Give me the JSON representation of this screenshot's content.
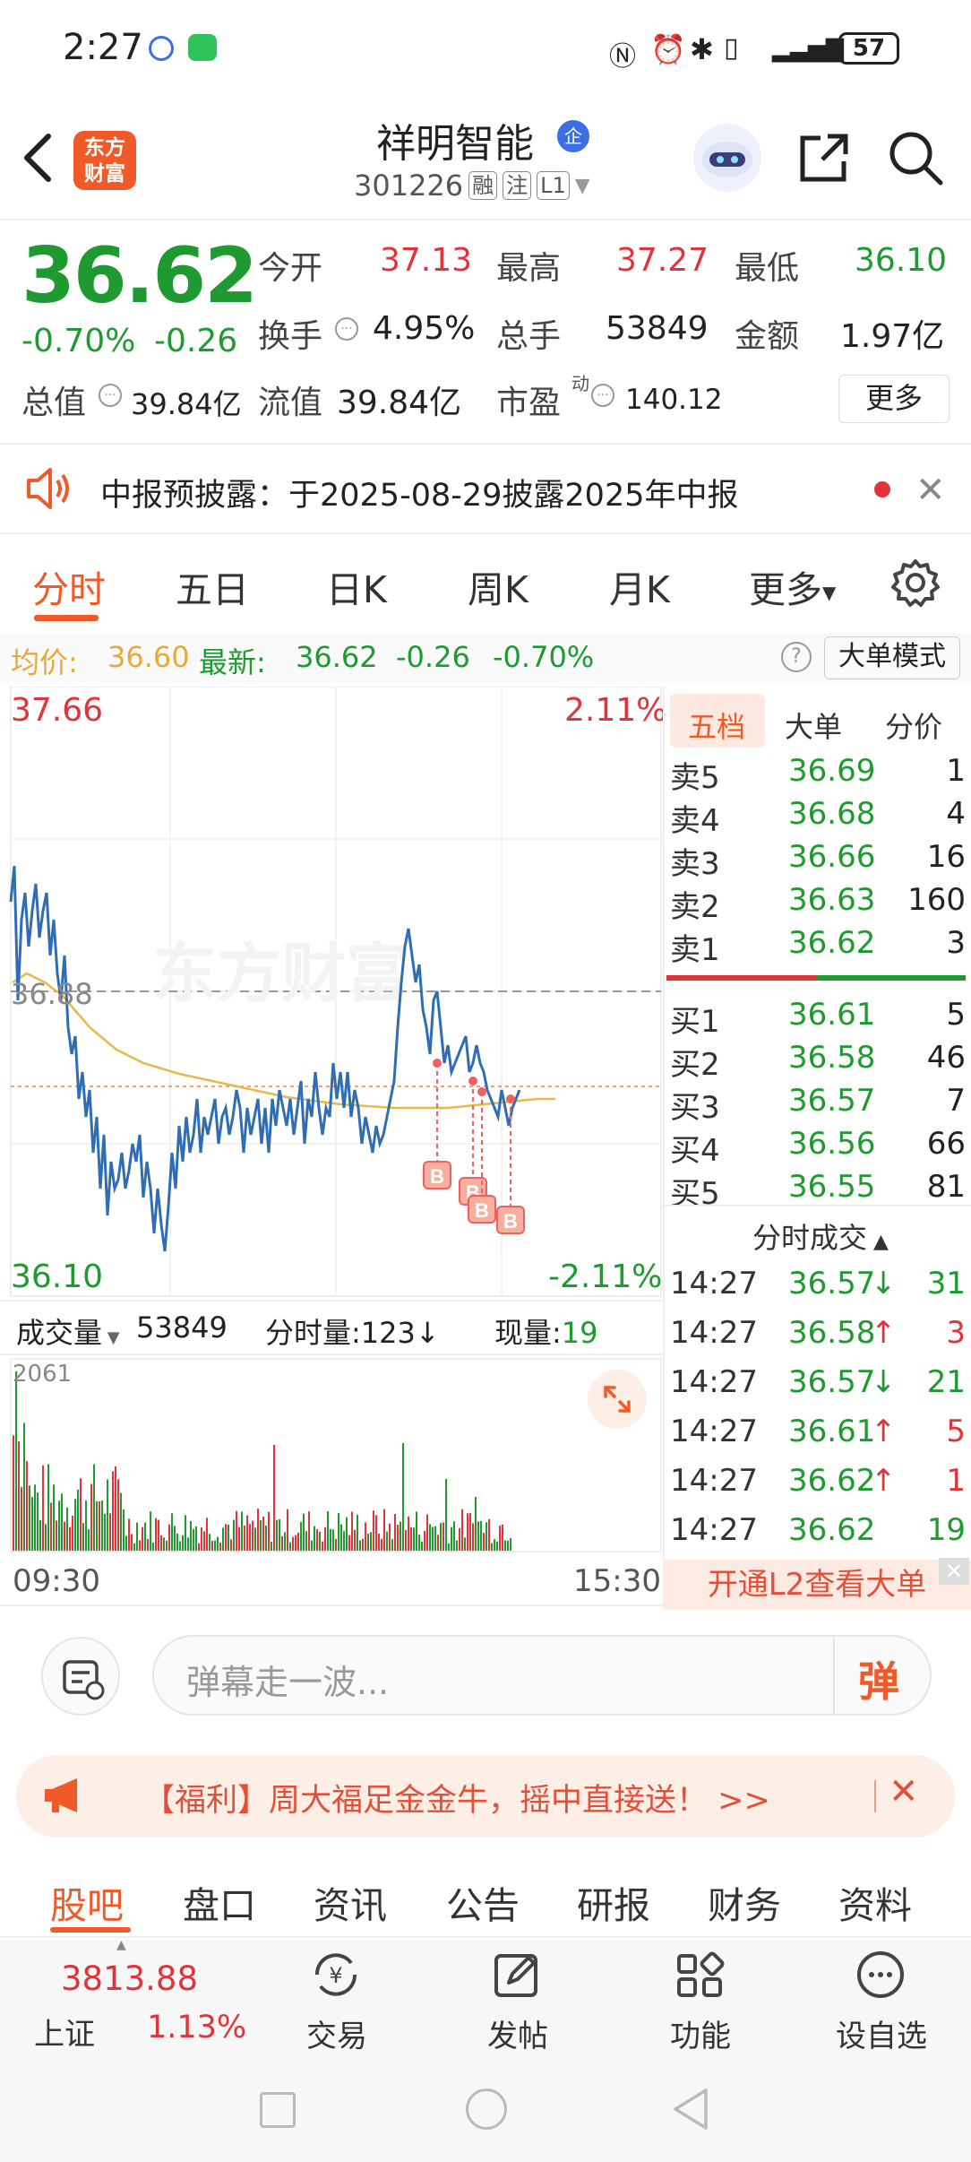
{
  "status": {
    "time": "2:27",
    "battery": "57"
  },
  "header": {
    "logo_text_line1": "东方",
    "logo_text_line2": "财富",
    "stock_name": "祥明智能",
    "badge": "企",
    "code": "301226",
    "tags": [
      "融",
      "注",
      "L1"
    ]
  },
  "quote": {
    "price": "36.62",
    "change_pct": "-0.70%",
    "change_abs": "-0.26",
    "open_label": "今开",
    "open": "37.13",
    "high_label": "最高",
    "high": "37.27",
    "low_label": "最低",
    "low": "36.10",
    "turnover_label": "换手",
    "turnover": "4.95%",
    "volume_label": "总手",
    "volume": "53849",
    "amount_label": "金额",
    "amount": "1.97亿",
    "mcap_label": "总值",
    "mcap": "39.84亿",
    "float_label": "流值",
    "float": "39.84亿",
    "pe_label": "市盈",
    "pe_sup": "动",
    "pe": "140.12",
    "more": "更多"
  },
  "notice": {
    "text": "中报预披露：于2025-08-29披露2025年中报"
  },
  "tabs": [
    "分时",
    "五日",
    "日K",
    "周K",
    "月K",
    "更多"
  ],
  "info": {
    "avg_label": "均价:",
    "avg": "36.60",
    "latest_label": "最新:",
    "latest": "36.62",
    "latest_chg": "-0.26",
    "latest_pct": "-0.70%",
    "big_mode": "大单模式"
  },
  "chart": {
    "top_price": "37.66",
    "top_pct": "2.11%",
    "bottom_price": "36.10",
    "bottom_pct": "-2.11%",
    "ref_price": "36.88",
    "watermark": "东方财富",
    "b_marker": "B",
    "volume_label": "成交量",
    "volume_total": "53849",
    "tick_label": "分时量:123↓",
    "current_label": "现量:",
    "current": "19",
    "vol_max": "2061",
    "time_start": "09:30",
    "time_end": "15:30"
  },
  "orderbook": {
    "tabs": [
      "五档",
      "大单",
      "分价"
    ],
    "asks": [
      {
        "label": "卖5",
        "price": "36.69",
        "qty": "1"
      },
      {
        "label": "卖4",
        "price": "36.68",
        "qty": "4"
      },
      {
        "label": "卖3",
        "price": "36.66",
        "qty": "16"
      },
      {
        "label": "卖2",
        "price": "36.63",
        "qty": "160"
      },
      {
        "label": "卖1",
        "price": "36.62",
        "qty": "3"
      }
    ],
    "bids": [
      {
        "label": "买1",
        "price": "36.61",
        "qty": "5"
      },
      {
        "label": "买2",
        "price": "36.58",
        "qty": "46"
      },
      {
        "label": "买3",
        "price": "36.57",
        "qty": "7"
      },
      {
        "label": "买4",
        "price": "36.56",
        "qty": "66"
      },
      {
        "label": "买5",
        "price": "36.55",
        "qty": "81"
      }
    ],
    "trades_header": "分时成交",
    "trades": [
      {
        "time": "14:27",
        "price": "36.57",
        "dir": "↓",
        "qty": "31",
        "color": "green"
      },
      {
        "time": "14:27",
        "price": "36.58",
        "dir": "↑",
        "qty": "3",
        "color": "red"
      },
      {
        "time": "14:27",
        "price": "36.57",
        "dir": "↓",
        "qty": "21",
        "color": "green"
      },
      {
        "time": "14:27",
        "price": "36.61",
        "dir": "↑",
        "qty": "5",
        "color": "red"
      },
      {
        "time": "14:27",
        "price": "36.62",
        "dir": "↑",
        "qty": "1",
        "color": "red"
      },
      {
        "time": "14:27",
        "price": "36.62",
        "dir": "",
        "qty": "19",
        "color": "green"
      }
    ],
    "l2_banner": "开通L2查看大单"
  },
  "comment": {
    "placeholder": "弹幕走一波...",
    "button": "弹"
  },
  "promo": {
    "text": "【福利】周大福足金金牛，摇中直接送！ >>"
  },
  "bottom_tabs": [
    "股吧",
    "盘口",
    "资讯",
    "公告",
    "研报",
    "财务",
    "资料"
  ],
  "nav": {
    "index_value": "3813.88",
    "index_name": "上证",
    "index_pct": "1.13%",
    "items": [
      "交易",
      "发帖",
      "功能",
      "设自选"
    ]
  },
  "colors": {
    "accent": "#f05a28",
    "up": "#e0333a",
    "down": "#1e9a30",
    "line": "#2f6db5",
    "avg": "#e9b84a"
  }
}
